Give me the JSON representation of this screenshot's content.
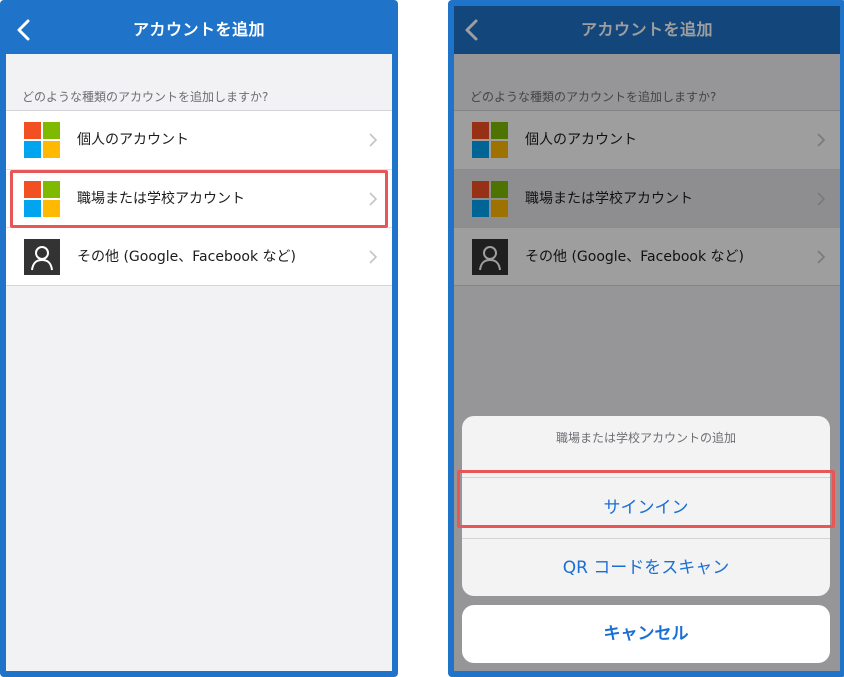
{
  "colors": {
    "frame": "#1f73c9",
    "nav_bar": "#1f73c9",
    "highlight": "#e85757",
    "action_text": "#1a6fd4",
    "ms_red": "#f25022",
    "ms_green": "#7fba00",
    "ms_blue": "#00a4ef",
    "ms_yellow": "#ffb900"
  },
  "left_screen": {
    "nav_title": "アカウントを追加",
    "back_icon": "chevron-left-icon",
    "prompt": "どのような種類のアカウントを追加しますか?",
    "items": [
      {
        "label": "個人のアカウント",
        "icon": "microsoft-logo-icon"
      },
      {
        "label": "職場または学校アカウント",
        "icon": "microsoft-logo-icon",
        "highlighted": true
      },
      {
        "label": "その他 (Google、Facebook など)",
        "icon": "person-icon"
      }
    ]
  },
  "right_screen": {
    "nav_title": "アカウントを追加",
    "back_icon": "chevron-left-icon",
    "prompt": "どのような種類のアカウントを追加しますか?",
    "items": [
      {
        "label": "個人のアカウント",
        "icon": "microsoft-logo-icon"
      },
      {
        "label": "職場または学校アカウント",
        "icon": "microsoft-logo-icon",
        "selected": true
      },
      {
        "label": "その他 (Google、Facebook など)",
        "icon": "person-icon"
      }
    ],
    "action_sheet": {
      "title": "職場または学校アカウントの追加",
      "sign_in_label": "サインイン",
      "qr_label": "QR コードをスキャン",
      "cancel_label": "キャンセル"
    }
  }
}
